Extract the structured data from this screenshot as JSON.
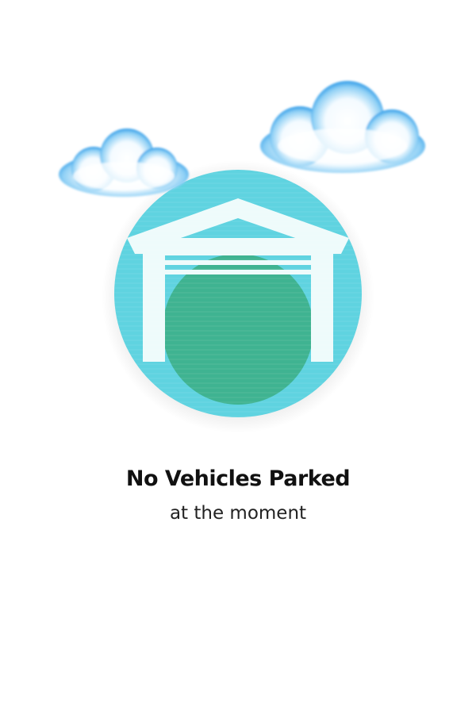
{
  "empty_state": {
    "title": "No Vehicles Parked",
    "subtitle": "at the moment"
  },
  "icons": {
    "main": "garage-icon",
    "decor_left": "cloud-icon",
    "decor_right": "cloud-icon"
  },
  "colors": {
    "badge_fill": "#5fd3e0",
    "garage_fill": "#eefbfb",
    "door_fill": "#3fb391",
    "cloud_edge": "#2f9be8",
    "cloud_center": "#ffffff",
    "title_text": "#111111"
  }
}
